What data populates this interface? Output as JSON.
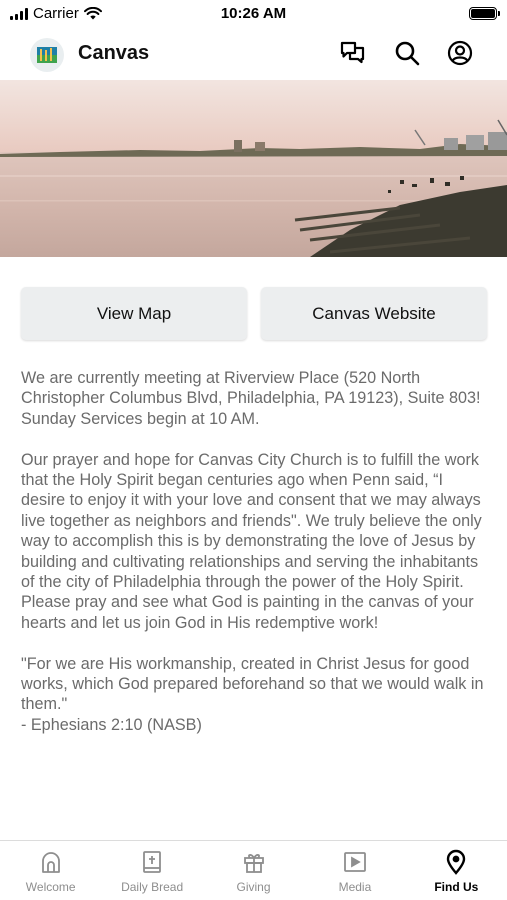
{
  "status_bar": {
    "carrier": "Carrier",
    "time": "10:26 AM"
  },
  "header": {
    "title": "Canvas"
  },
  "icons": {
    "chat": "chat-bubbles-icon",
    "search": "search-icon",
    "profile": "profile-icon"
  },
  "buttons": {
    "view_map": "View Map",
    "website": "Canvas Website"
  },
  "content": {
    "paragraph1": "We are currently meeting at Riverview Place (520 North Christopher Columbus Blvd, Philadelphia, PA 19123), Suite 803! Sunday Services begin at 10 AM.",
    "paragraph2": "Our prayer and hope for Canvas City Church is to fulfill the work that the Holy Spirit began centuries ago when Penn said, “I desire to enjoy it with your love and consent that we may always live together as neighbors and friends\". We truly believe the only way to accomplish this is by demonstrating the love of Jesus by building and cultivating relationships and serving the inhabitants of the city of Philadelphia through the power of the Holy Spirit. Please pray and see what God is painting in the canvas of your hearts and let us join God in His redemptive work!",
    "quote": "\"For we are His workmanship, created in Christ Jesus for good works, which God prepared beforehand so that we would walk in them.\"",
    "citation": "- Ephesians 2:10 (NASB)"
  },
  "tabs": [
    {
      "label": "Welcome",
      "icon": "church-icon",
      "active": false
    },
    {
      "label": "Daily Bread",
      "icon": "bible-icon",
      "active": false
    },
    {
      "label": "Giving",
      "icon": "gift-icon",
      "active": false
    },
    {
      "label": "Media",
      "icon": "play-icon",
      "active": false
    },
    {
      "label": "Find Us",
      "icon": "location-pin-icon",
      "active": true
    }
  ],
  "colors": {
    "text_muted": "#6b6b6b",
    "button_bg": "#eceeef",
    "tab_inactive": "#8e8e8e",
    "tab_active": "#000000"
  }
}
